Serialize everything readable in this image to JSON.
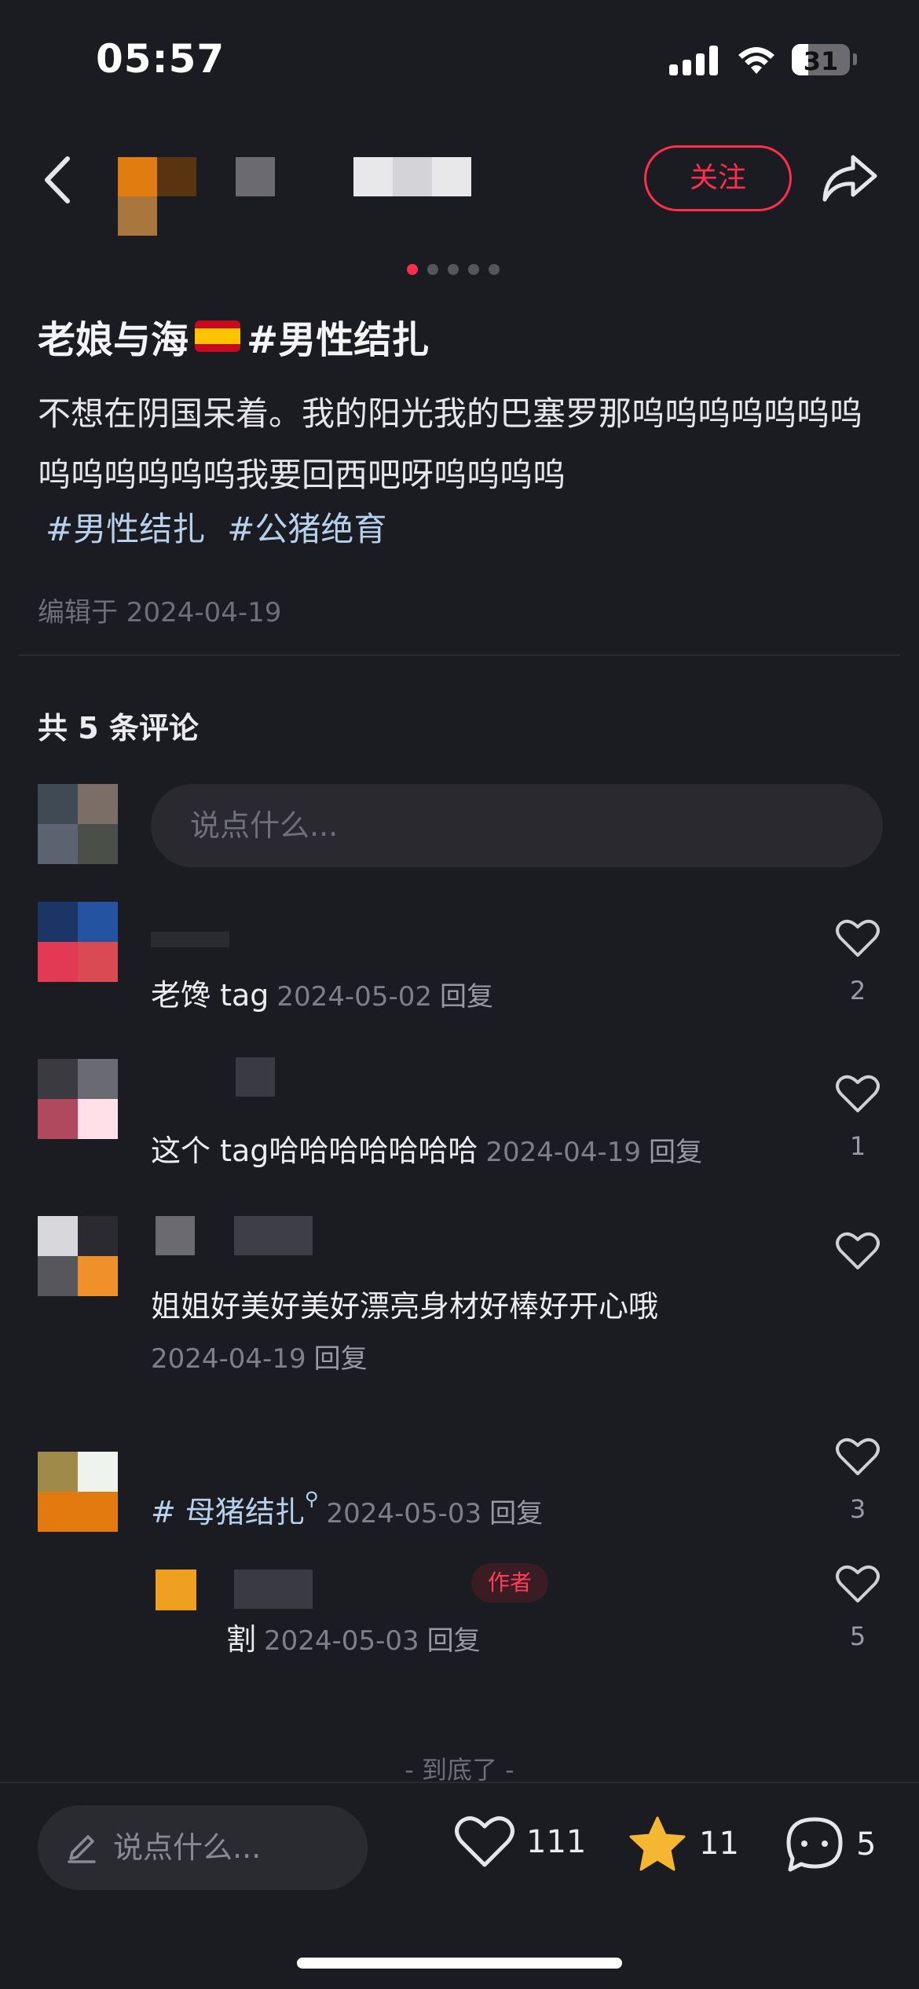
{
  "status_bar": {
    "time": "05:57",
    "battery": "31"
  },
  "header": {
    "follow_label": "关注"
  },
  "carousel": {
    "total": 5,
    "active": 1
  },
  "post": {
    "title": "老娘与海",
    "title_tag": "#男性结扎",
    "body": "不想在阴国呆着。我的阳光我的巴塞罗那呜呜呜呜呜呜呜呜呜呜呜呜呜我要回西吧呀呜呜呜呜",
    "tags": [
      "#男性结扎",
      "#公猪绝育"
    ],
    "edited": "编辑于 2024-04-19"
  },
  "comments_header": "共 5 条评论",
  "comment_input_placeholder": "说点什么...",
  "comments": [
    {
      "text": "老馋 tag",
      "date": "2024-05-02",
      "reply": "回复",
      "likes": "2"
    },
    {
      "text": "这个 tag哈哈哈哈哈哈哈",
      "date": "2024-04-19",
      "reply": "回复",
      "likes": "1"
    },
    {
      "text": "姐姐好美好美好漂亮身材好棒好开心哦",
      "date": "2024-04-19",
      "reply": "回复",
      "likes": ""
    },
    {
      "text": "# 母猪结扎",
      "date": "2024-05-03",
      "reply": "回复",
      "likes": "3"
    },
    {
      "text": "割",
      "date": "2024-05-03",
      "reply": "回复",
      "likes": "5",
      "badge": "作者"
    }
  ],
  "end_text": "- 到底了 -",
  "bottom_bar": {
    "input_placeholder": "说点什么...",
    "likes": "111",
    "stars": "11",
    "comments": "5"
  },
  "colors": {
    "accent": "#ff2e4d",
    "tag": "#b7d1ec",
    "star": "#f5b731",
    "background": "#1b1b22"
  },
  "icons": [
    "back-icon",
    "share-icon",
    "heart-icon",
    "star-icon",
    "comment-icon",
    "pencil-icon",
    "search-icon"
  ]
}
